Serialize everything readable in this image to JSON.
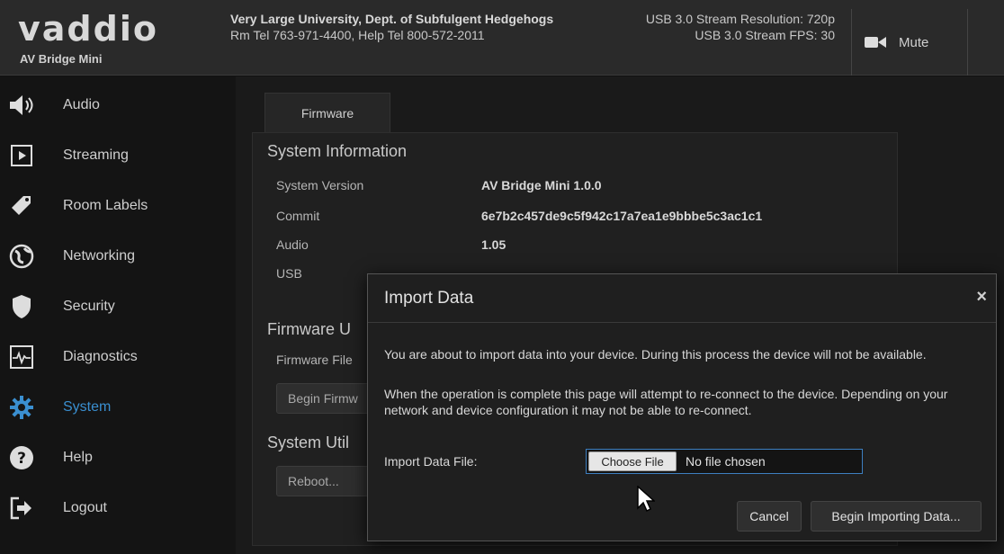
{
  "header": {
    "logo": "vaddio",
    "product": "AV Bridge Mini",
    "org_name": "Very Large University, Dept. of Subfulgent Hedgehogs",
    "org_contact": "Rm Tel 763-971-4400, Help Tel 800-572-2011",
    "stream_resolution": "USB 3.0 Stream Resolution: 720p",
    "stream_fps": "USB 3.0 Stream FPS: 30",
    "mute_label": "Mute"
  },
  "sidebar": {
    "items": [
      {
        "label": "Audio",
        "icon": "speaker-icon"
      },
      {
        "label": "Streaming",
        "icon": "play-icon"
      },
      {
        "label": "Room Labels",
        "icon": "tag-icon"
      },
      {
        "label": "Networking",
        "icon": "globe-icon"
      },
      {
        "label": "Security",
        "icon": "shield-icon"
      },
      {
        "label": "Diagnostics",
        "icon": "pulse-icon"
      },
      {
        "label": "System",
        "icon": "gear-icon",
        "active": true
      },
      {
        "label": "Help",
        "icon": "question-icon"
      },
      {
        "label": "Logout",
        "icon": "logout-icon"
      }
    ]
  },
  "main": {
    "tab": "Firmware",
    "system_info": {
      "title": "System Information",
      "rows": [
        {
          "key": "System Version",
          "value": "AV Bridge Mini 1.0.0"
        },
        {
          "key": "Commit",
          "value": "6e7b2c457de9c5f942c17a7ea1e9bbbe5c3ac1c1"
        },
        {
          "key": "Audio",
          "value": "1.05"
        },
        {
          "key": "USB",
          "value": ""
        }
      ]
    },
    "firmware_update": {
      "title": "Firmware U",
      "file_label": "Firmware File",
      "begin_label": "Begin Firmw"
    },
    "system_utilities": {
      "title": "System Util",
      "reboot_label": "Reboot..."
    }
  },
  "modal": {
    "title": "Import Data",
    "close": "×",
    "text1": "You are about to import data into your device. During this process the device will not be available.",
    "text2": "When the operation is complete this page will attempt to re-connect to the device. Depending on your network and device configuration it may not be able to re-connect.",
    "file_label": "Import Data File:",
    "choose_file": "Choose File",
    "no_file": "No file chosen",
    "cancel": "Cancel",
    "begin": "Begin Importing Data..."
  },
  "colors": {
    "accent": "#3a8fd0",
    "header_bg": "#2a2a2a",
    "sidebar_bg": "#141414"
  }
}
